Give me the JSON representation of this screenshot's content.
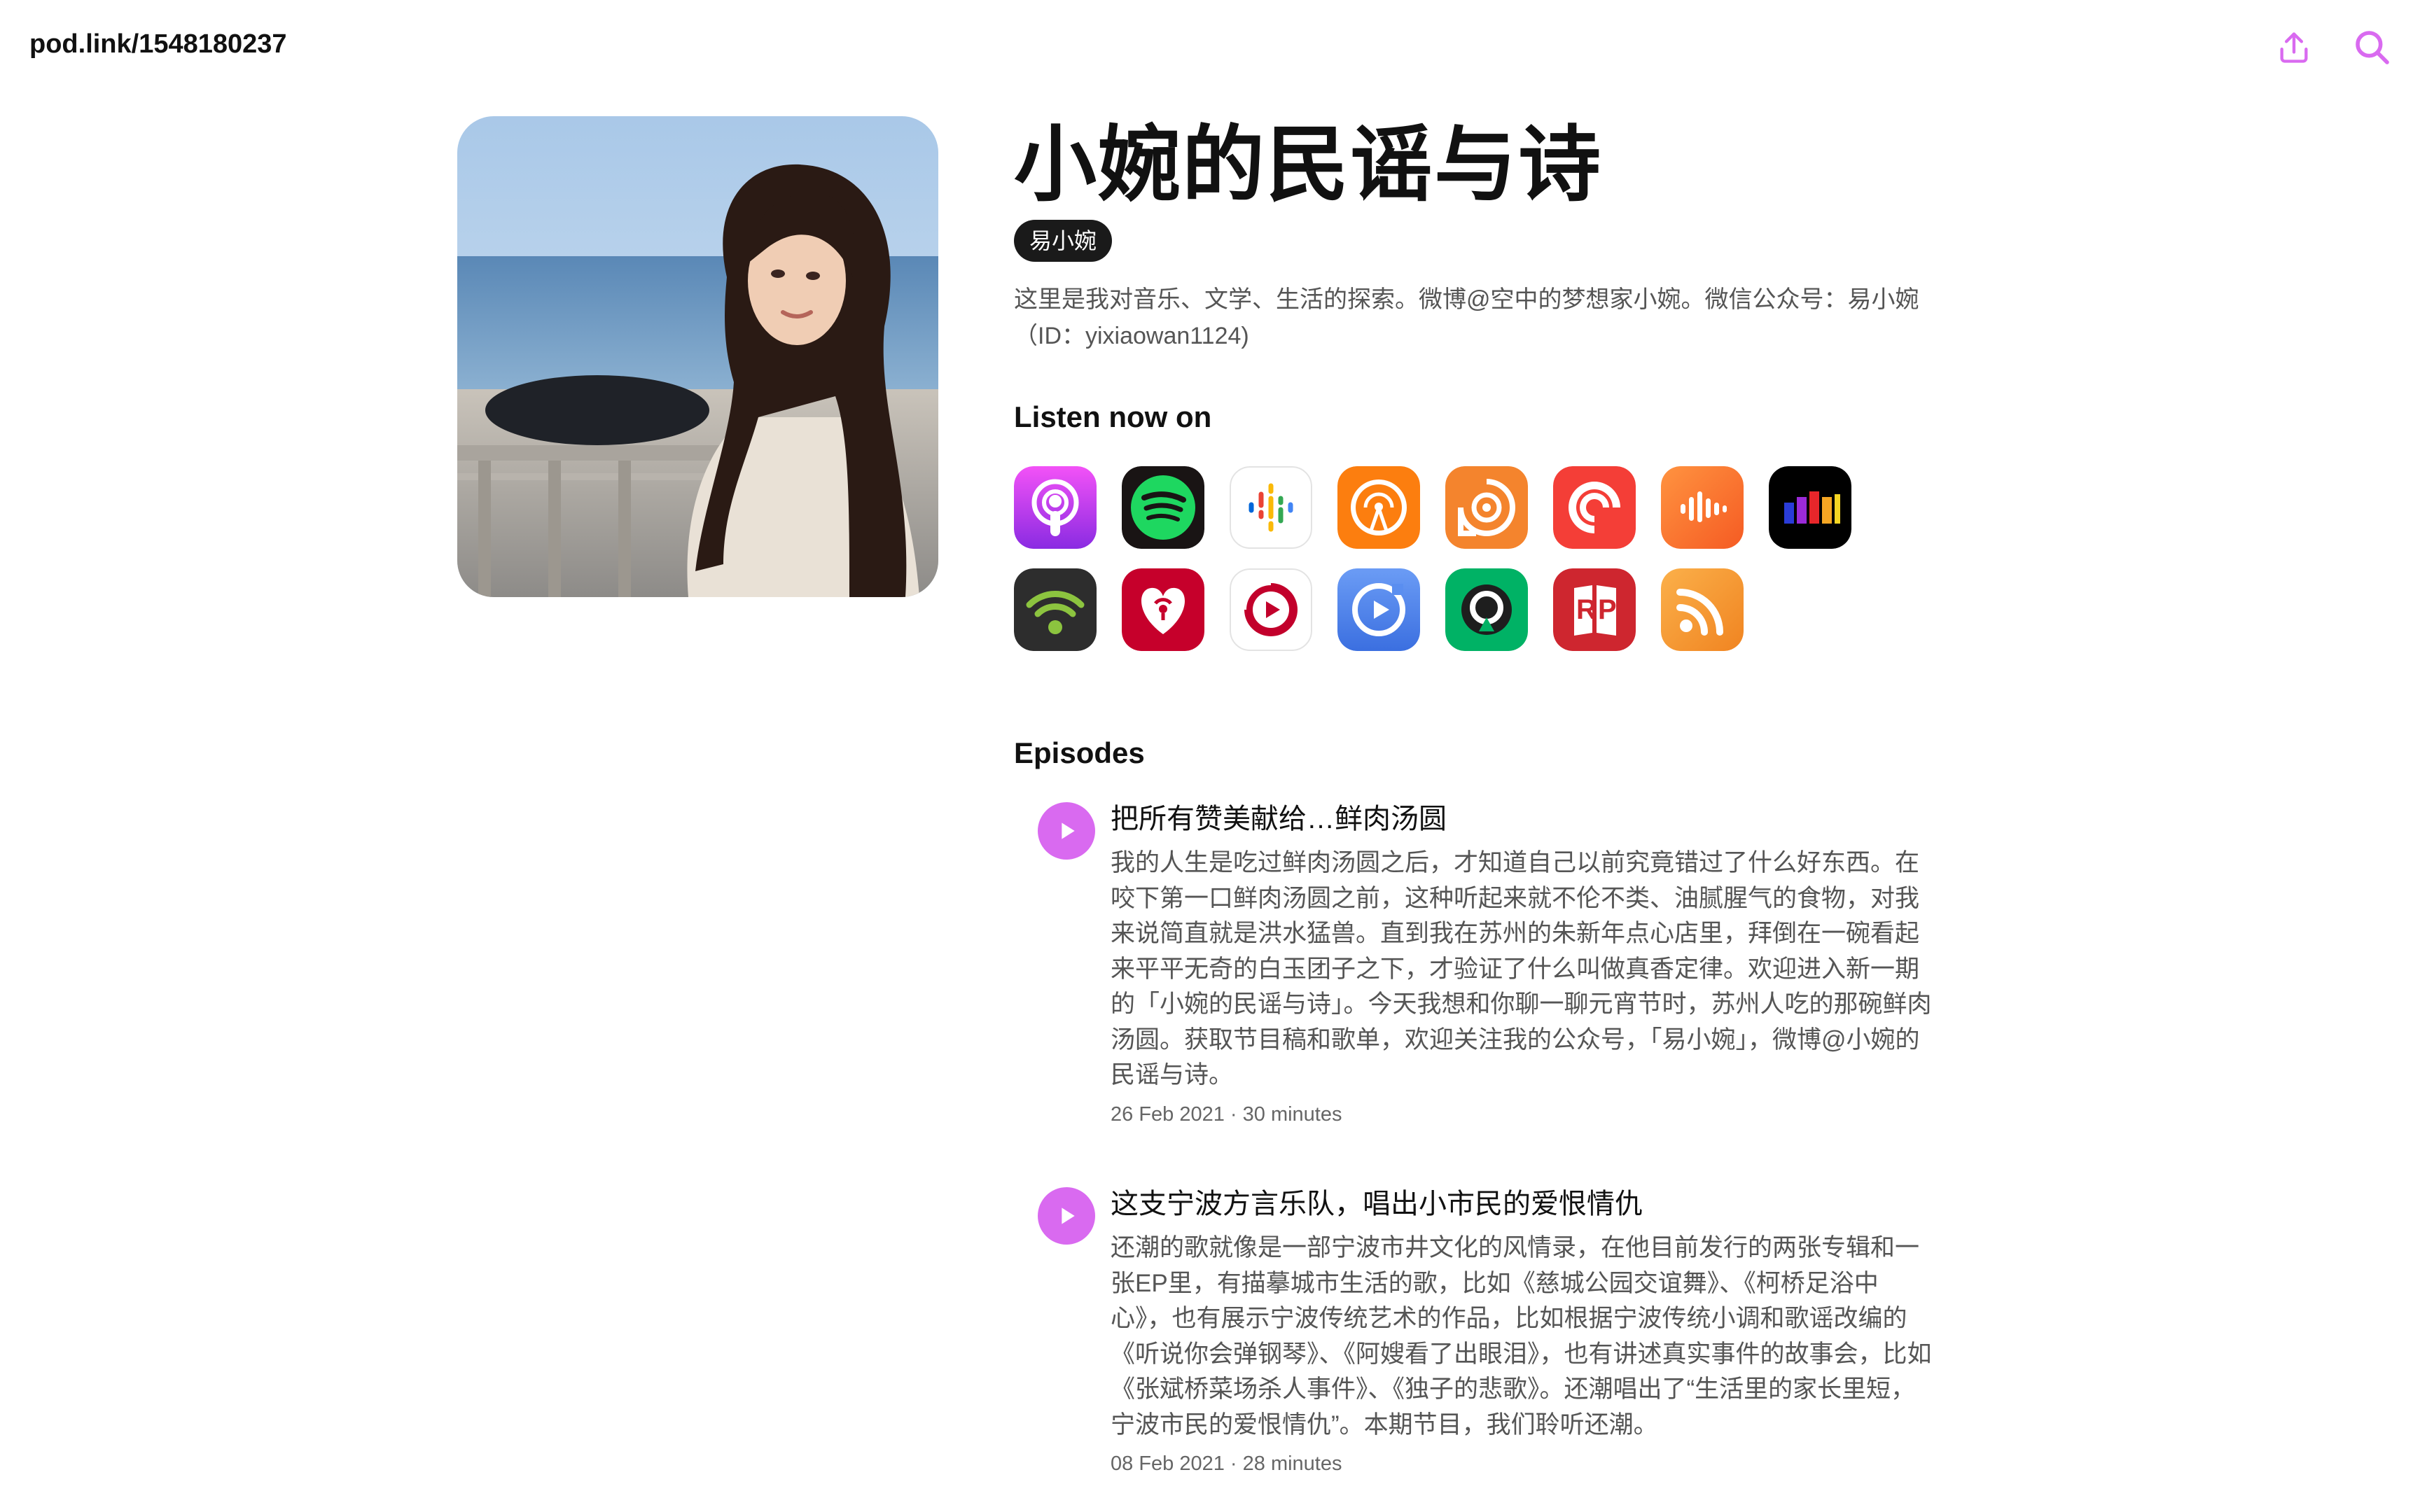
{
  "header": {
    "site_link": "pod.link/1548180237",
    "share_icon": "share-upload-icon",
    "search_icon": "search-icon",
    "accent_color": "#d96af0"
  },
  "podcast": {
    "title": "小婉的民谣与诗",
    "author": "易小婉",
    "description": "这里是我对音乐、文学、生活的探索。微博@空中的梦想家小婉。微信公众号：易小婉（ID：yixiaowan1124)"
  },
  "listen": {
    "heading": "Listen now on",
    "platforms": [
      {
        "name": "apple-podcasts-icon"
      },
      {
        "name": "spotify-icon"
      },
      {
        "name": "google-podcasts-icon"
      },
      {
        "name": "overcast-icon"
      },
      {
        "name": "podcast-addict-icon"
      },
      {
        "name": "pocket-casts-icon"
      },
      {
        "name": "castbox-icon"
      },
      {
        "name": "deezer-icon"
      },
      {
        "name": "podcast-republic-icon"
      },
      {
        "name": "iheartradio-icon"
      },
      {
        "name": "player-fm-icon"
      },
      {
        "name": "podcast-app-icon"
      },
      {
        "name": "castro-icon"
      },
      {
        "name": "radio-public-icon"
      },
      {
        "name": "rss-feed-icon"
      }
    ]
  },
  "episodes": {
    "heading": "Episodes",
    "items": [
      {
        "title": "把所有赞美献给…鲜肉汤圆",
        "description": "我的人生是吃过鲜肉汤圆之后，才知道自己以前究竟错过了什么好东西。在咬下第一口鲜肉汤圆之前，这种听起来就不伦不类、油腻腥气的食物，对我来说简直就是洪水猛兽。直到我在苏州的朱新年点心店里，拜倒在一碗看起来平平无奇的白玉团子之下，才验证了什么叫做真香定律。欢迎进入新一期的「小婉的民谣与诗」。今天我想和你聊一聊元宵节时，苏州人吃的那碗鲜肉汤圆。获取节目稿和歌单，欢迎关注我的公众号，「易小婉」，微博@小婉的民谣与诗。",
        "meta": "26 Feb 2021 · 30 minutes"
      },
      {
        "title": "这支宁波方言乐队，唱出小市民的爱恨情仇",
        "description": "还潮的歌就像是一部宁波市井文化的风情录，在他目前发行的两张专辑和一张EP里，有描摹城市生活的歌，比如《慈城公园交谊舞》、《柯桥足浴中心》，也有展示宁波传统艺术的作品，比如根据宁波传统小调和歌谣改编的《听说你会弹钢琴》、《阿嫂看了出眼泪》，也有讲述真实事件的故事会，比如《张斌桥菜场杀人事件》、《独子的悲歌》。还潮唱出了“生活里的家长里短，宁波市民的爱恨情仇”。本期节目，我们聆听还潮。",
        "meta": "08 Feb 2021 · 28 minutes"
      }
    ]
  }
}
